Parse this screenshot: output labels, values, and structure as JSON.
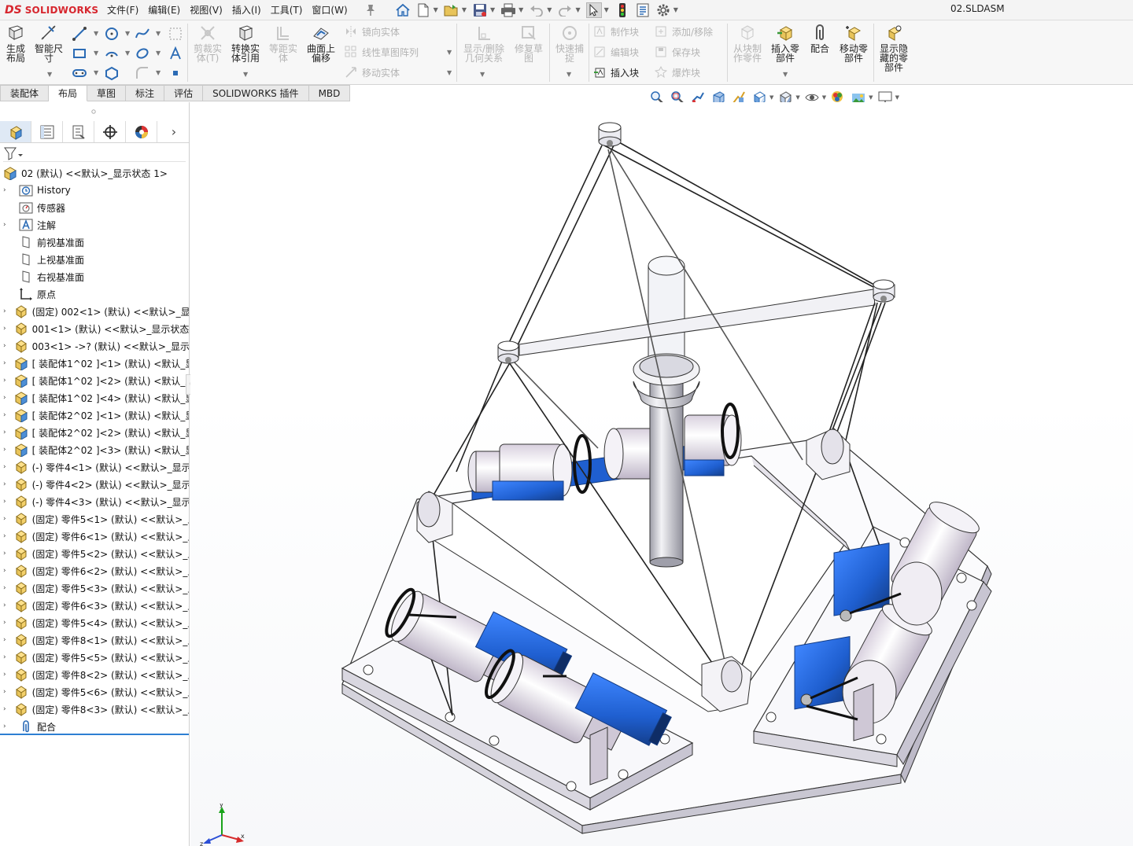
{
  "app": {
    "logo_mark": "DS",
    "logo_text": "SOLIDWORKS",
    "document_title": "02.SLDASM"
  },
  "menu": [
    {
      "label": "文件(F)"
    },
    {
      "label": "编辑(E)"
    },
    {
      "label": "视图(V)"
    },
    {
      "label": "插入(I)"
    },
    {
      "label": "工具(T)"
    },
    {
      "label": "窗口(W)"
    }
  ],
  "quick_access_icons": [
    "pin-icon",
    "home-icon",
    "new-document-icon",
    "open-icon",
    "save-icon",
    "print-icon",
    "undo-icon",
    "redo-icon",
    "select-arrow-icon",
    "rebuild-traffic-light-icon",
    "file-properties-icon",
    "options-gear-icon"
  ],
  "command_manager": {
    "generate_layout": "生成\n布局",
    "smart_dimension": "智能尺\n寸",
    "trim_entities": "剪裁实\n体(T)",
    "convert_entities": "转换实\n体引用",
    "offset_entities": "等距实\n体",
    "offset_on_surface": "曲面上\n偏移",
    "mirror_entities": "镜向实体",
    "linear_pattern": "线性草图阵列",
    "move_entities": "移动实体",
    "display_relations": "显示/删除\n几何关系",
    "repair_sketch": "修复草\n图",
    "quick_snaps": "快速捕\n捉",
    "make_block": "制作块",
    "edit_block": "编辑块",
    "insert_block": "插入块",
    "add_remove": "添加/移除",
    "save_block": "保存块",
    "explode_block": "爆炸块",
    "make_part_from_block": "从块制\n作零件",
    "insert_component": "插入零\n部件",
    "mate": "配合",
    "move_component": "移动零\n部件",
    "show_hidden_components": "显示隐\n藏的零\n部件"
  },
  "tabs": [
    {
      "label": "装配体",
      "active": false
    },
    {
      "label": "布局",
      "active": true
    },
    {
      "label": "草图",
      "active": false
    },
    {
      "label": "标注",
      "active": false
    },
    {
      "label": "评估",
      "active": false
    },
    {
      "label": "SOLIDWORKS 插件",
      "active": false
    },
    {
      "label": "MBD",
      "active": false
    }
  ],
  "view_toolbar_icons": [
    "zoom-to-fit-icon",
    "zoom-to-area-icon",
    "previous-view-icon",
    "section-view-icon",
    "dynamic-annotation-icon",
    "view-orientation-icon",
    "display-style-icon",
    "hide-show-items-icon",
    "edit-appearance-icon",
    "apply-scene-icon",
    "view-settings-icon"
  ],
  "feature_manager": {
    "tabs": [
      "feature-manager-icon",
      "property-manager-icon",
      "configuration-manager-icon",
      "dimxpert-icon",
      "display-manager-icon"
    ],
    "root": "02  (默认) <<默认>_显示状态 1>",
    "items": [
      {
        "label": "History",
        "icon": "history-folder-icon",
        "expandable": true
      },
      {
        "label": "传感器",
        "icon": "sensor-icon",
        "expandable": false
      },
      {
        "label": "注解",
        "icon": "annotation-icon",
        "expandable": true
      },
      {
        "label": "前视基准面",
        "icon": "plane-icon",
        "expandable": false
      },
      {
        "label": "上视基准面",
        "icon": "plane-icon",
        "expandable": false
      },
      {
        "label": "右视基准面",
        "icon": "plane-icon",
        "expandable": false
      },
      {
        "label": "原点",
        "icon": "origin-icon",
        "expandable": false
      },
      {
        "label": "(固定) 002<1> (默认) <<默认>_显",
        "icon": "part-icon",
        "expandable": true
      },
      {
        "label": "001<1> (默认) <<默认>_显示状态",
        "icon": "part-icon",
        "expandable": true
      },
      {
        "label": "003<1> ->? (默认) <<默认>_显示",
        "icon": "part-icon",
        "expandable": true
      },
      {
        "label": "[ 装配体1^02 ]<1> (默认) <默认_显",
        "icon": "subassembly-icon",
        "expandable": true
      },
      {
        "label": "[ 装配体1^02 ]<2> (默认) <默认_显",
        "icon": "subassembly-icon",
        "expandable": true
      },
      {
        "label": "[ 装配体1^02 ]<4> (默认) <默认_显",
        "icon": "subassembly-icon",
        "expandable": true
      },
      {
        "label": "[ 装配体2^02 ]<1> (默认) <默认_显",
        "icon": "subassembly-icon",
        "expandable": true
      },
      {
        "label": "[ 装配体2^02 ]<2> (默认) <默认_显",
        "icon": "subassembly-icon",
        "expandable": true
      },
      {
        "label": "[ 装配体2^02 ]<3> (默认) <默认_显",
        "icon": "subassembly-icon",
        "expandable": true
      },
      {
        "label": "(-) 零件4<1> (默认) <<默认>_显示",
        "icon": "part-icon",
        "expandable": true
      },
      {
        "label": "(-) 零件4<2> (默认) <<默认>_显示",
        "icon": "part-icon",
        "expandable": true
      },
      {
        "label": "(-) 零件4<3> (默认) <<默认>_显示",
        "icon": "part-icon",
        "expandable": true
      },
      {
        "label": "(固定) 零件5<1> (默认) <<默认>_显",
        "icon": "part-icon",
        "expandable": true
      },
      {
        "label": "(固定) 零件6<1> (默认) <<默认>_显",
        "icon": "part-icon",
        "expandable": true
      },
      {
        "label": "(固定) 零件5<2> (默认) <<默认>_显",
        "icon": "part-icon",
        "expandable": true
      },
      {
        "label": "(固定) 零件6<2> (默认) <<默认>_显",
        "icon": "part-icon",
        "expandable": true
      },
      {
        "label": "(固定) 零件5<3> (默认) <<默认>_显",
        "icon": "part-icon",
        "expandable": true
      },
      {
        "label": "(固定) 零件6<3> (默认) <<默认>_显",
        "icon": "part-icon",
        "expandable": true
      },
      {
        "label": "(固定) 零件5<4> (默认) <<默认>_显",
        "icon": "part-icon",
        "expandable": true
      },
      {
        "label": "(固定) 零件8<1> (默认) <<默认>_显",
        "icon": "part-icon",
        "expandable": true
      },
      {
        "label": "(固定) 零件5<5> (默认) <<默认>_显",
        "icon": "part-icon",
        "expandable": true
      },
      {
        "label": "(固定) 零件8<2> (默认) <<默认>_显",
        "icon": "part-icon",
        "expandable": true
      },
      {
        "label": "(固定) 零件5<6> (默认) <<默认>_显",
        "icon": "part-icon",
        "expandable": true
      },
      {
        "label": "(固定) 零件8<3> (默认) <<默认>_显",
        "icon": "part-icon",
        "expandable": true
      },
      {
        "label": "配合",
        "icon": "mates-icon",
        "expandable": true
      }
    ]
  },
  "triad": {
    "x": "x",
    "y": "y",
    "z": "z"
  },
  "colors": {
    "brand": "#d7262e",
    "selection_blue": "#2d7fd3",
    "motor_blue": "#1f5fd0",
    "part_yellow": "#f3c43a"
  }
}
